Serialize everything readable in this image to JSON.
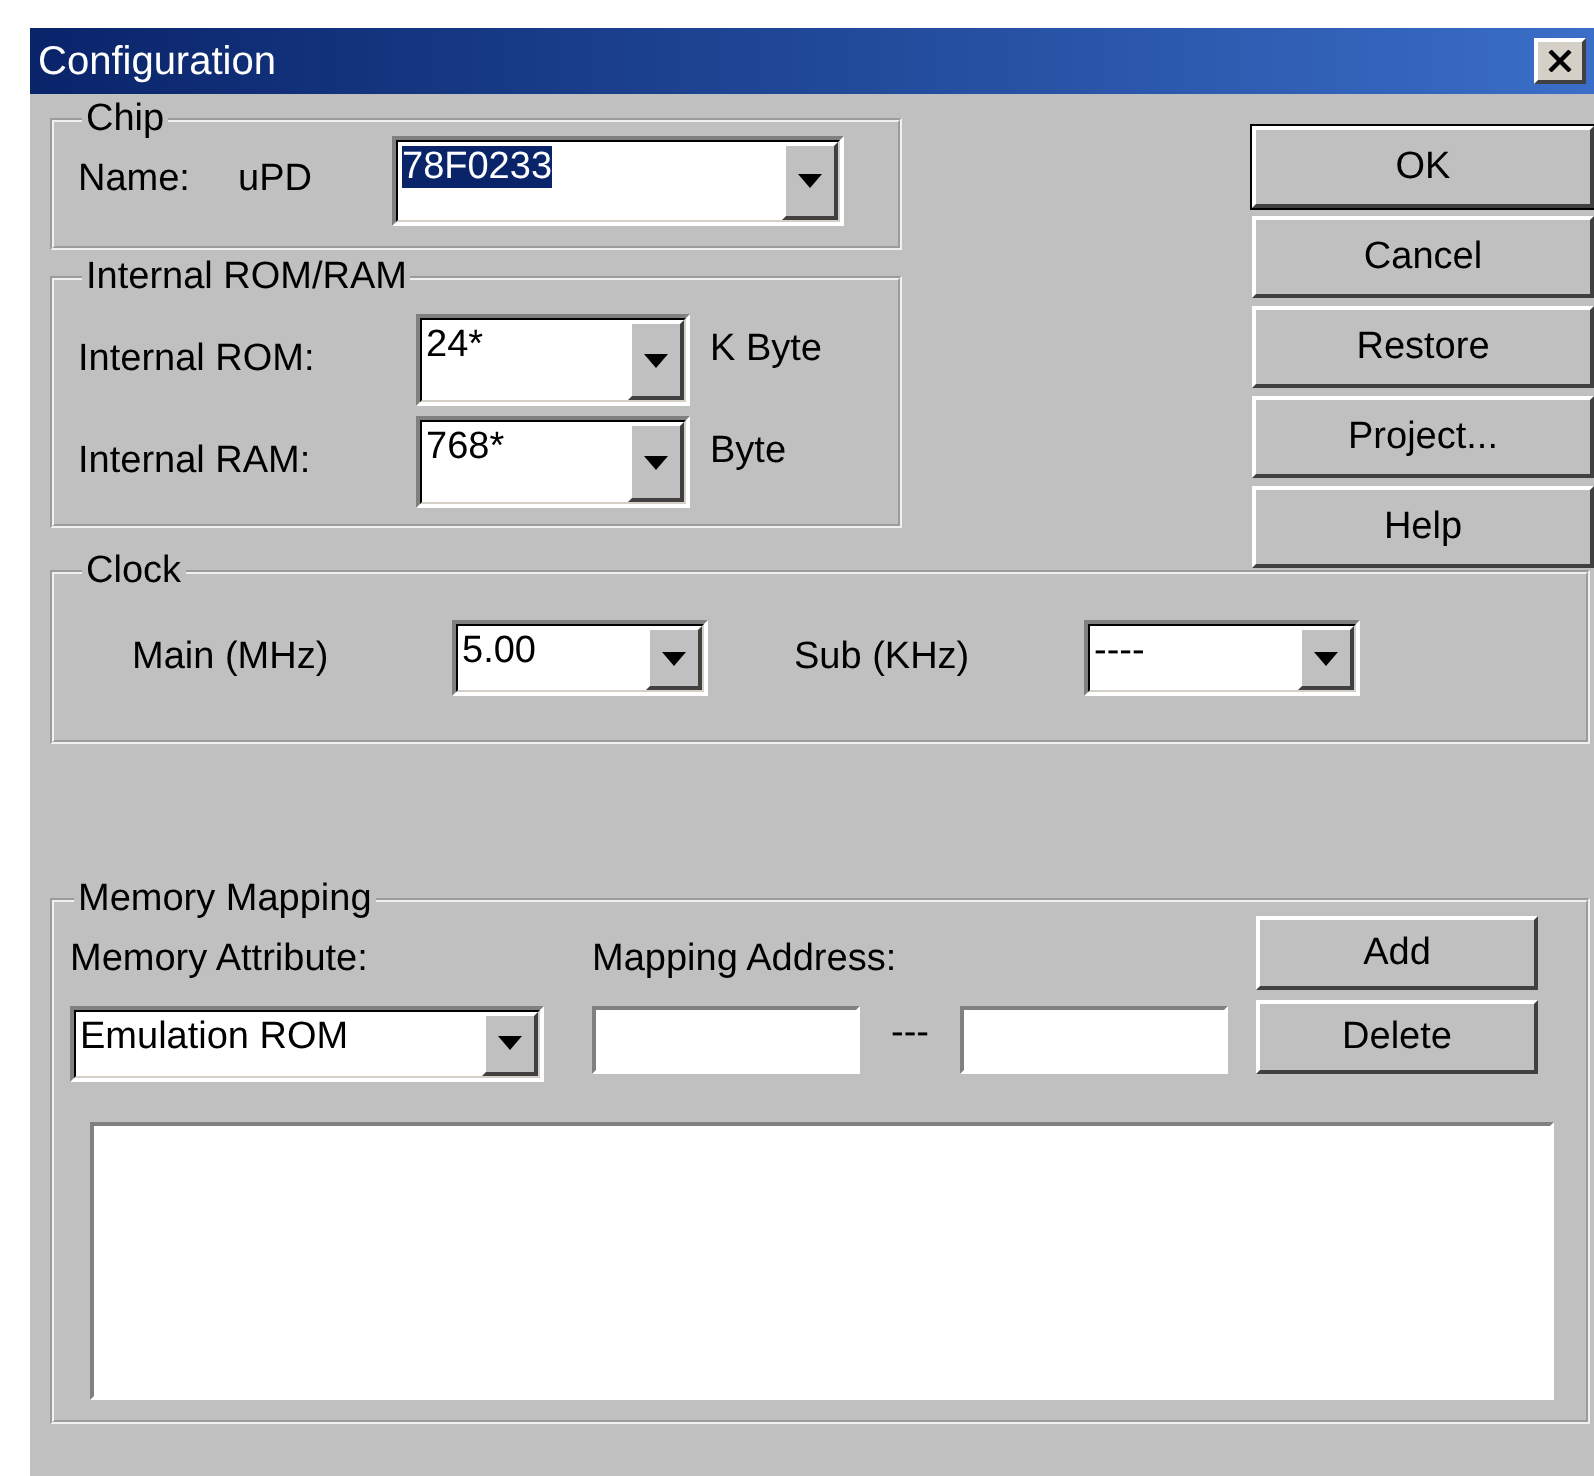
{
  "window": {
    "title": "Configuration"
  },
  "chip": {
    "legend": "Chip",
    "name_label": "Name:",
    "prefix": "uPD",
    "value": "78F0233",
    "value_selected": true
  },
  "internal_rom_ram": {
    "legend": "Internal ROM/RAM",
    "rows": [
      {
        "label": "Internal ROM:",
        "value": "24*",
        "unit": "K Byte"
      },
      {
        "label": "Internal RAM:",
        "value": "768*",
        "unit": "Byte"
      }
    ]
  },
  "buttons": [
    {
      "label": "OK",
      "default": true
    },
    {
      "label": "Cancel",
      "default": false
    },
    {
      "label": "Restore",
      "default": false
    },
    {
      "label": "Project...",
      "default": false
    },
    {
      "label": "Help",
      "default": false
    }
  ],
  "clock": {
    "legend": "Clock",
    "main_label": "Main (MHz)",
    "main_value": "5.00",
    "sub_label": "Sub (KHz)",
    "sub_value": "----"
  },
  "memory_mapping": {
    "legend": "Memory Mapping",
    "attribute_label": "Memory Attribute:",
    "attribute_value": "Emulation ROM",
    "address_label": "Mapping Address:",
    "separator": "---",
    "buttons": [
      "Add",
      "Delete"
    ]
  }
}
